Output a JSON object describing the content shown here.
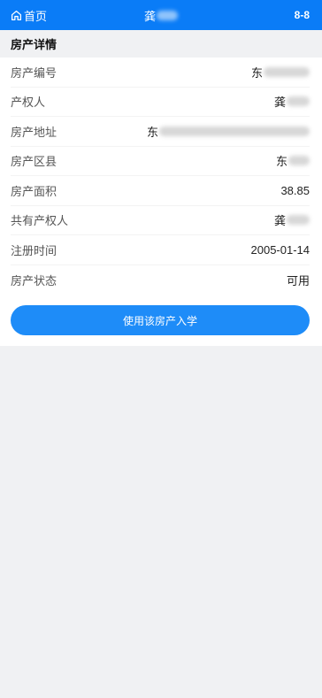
{
  "header": {
    "home_label": "首页",
    "title": "龚",
    "right_text": "8-8"
  },
  "section": {
    "title": "房产详情"
  },
  "details": [
    {
      "label": "房产编号",
      "value": "东",
      "obscured": true
    },
    {
      "label": "产权人",
      "value": "龚",
      "obscured": true
    },
    {
      "label": "房产地址",
      "value": "东",
      "obscured": true
    },
    {
      "label": "房产区县",
      "value": "东",
      "obscured": true
    },
    {
      "label": "房产面积",
      "value": "38.85",
      "obscured": false
    },
    {
      "label": "共有产权人",
      "value": "龚",
      "obscured": true
    },
    {
      "label": "注册时间",
      "value": "2005-01-14",
      "obscured": false
    },
    {
      "label": "房产状态",
      "value": "可用",
      "obscured": false
    }
  ],
  "actions": {
    "use_property_label": "使用该房产入学"
  },
  "colors": {
    "header_bg": "#0a7cf7",
    "button_bg": "#1e8cf8",
    "page_bg": "#f0f1f3"
  },
  "icons": {
    "home": "home-icon"
  }
}
